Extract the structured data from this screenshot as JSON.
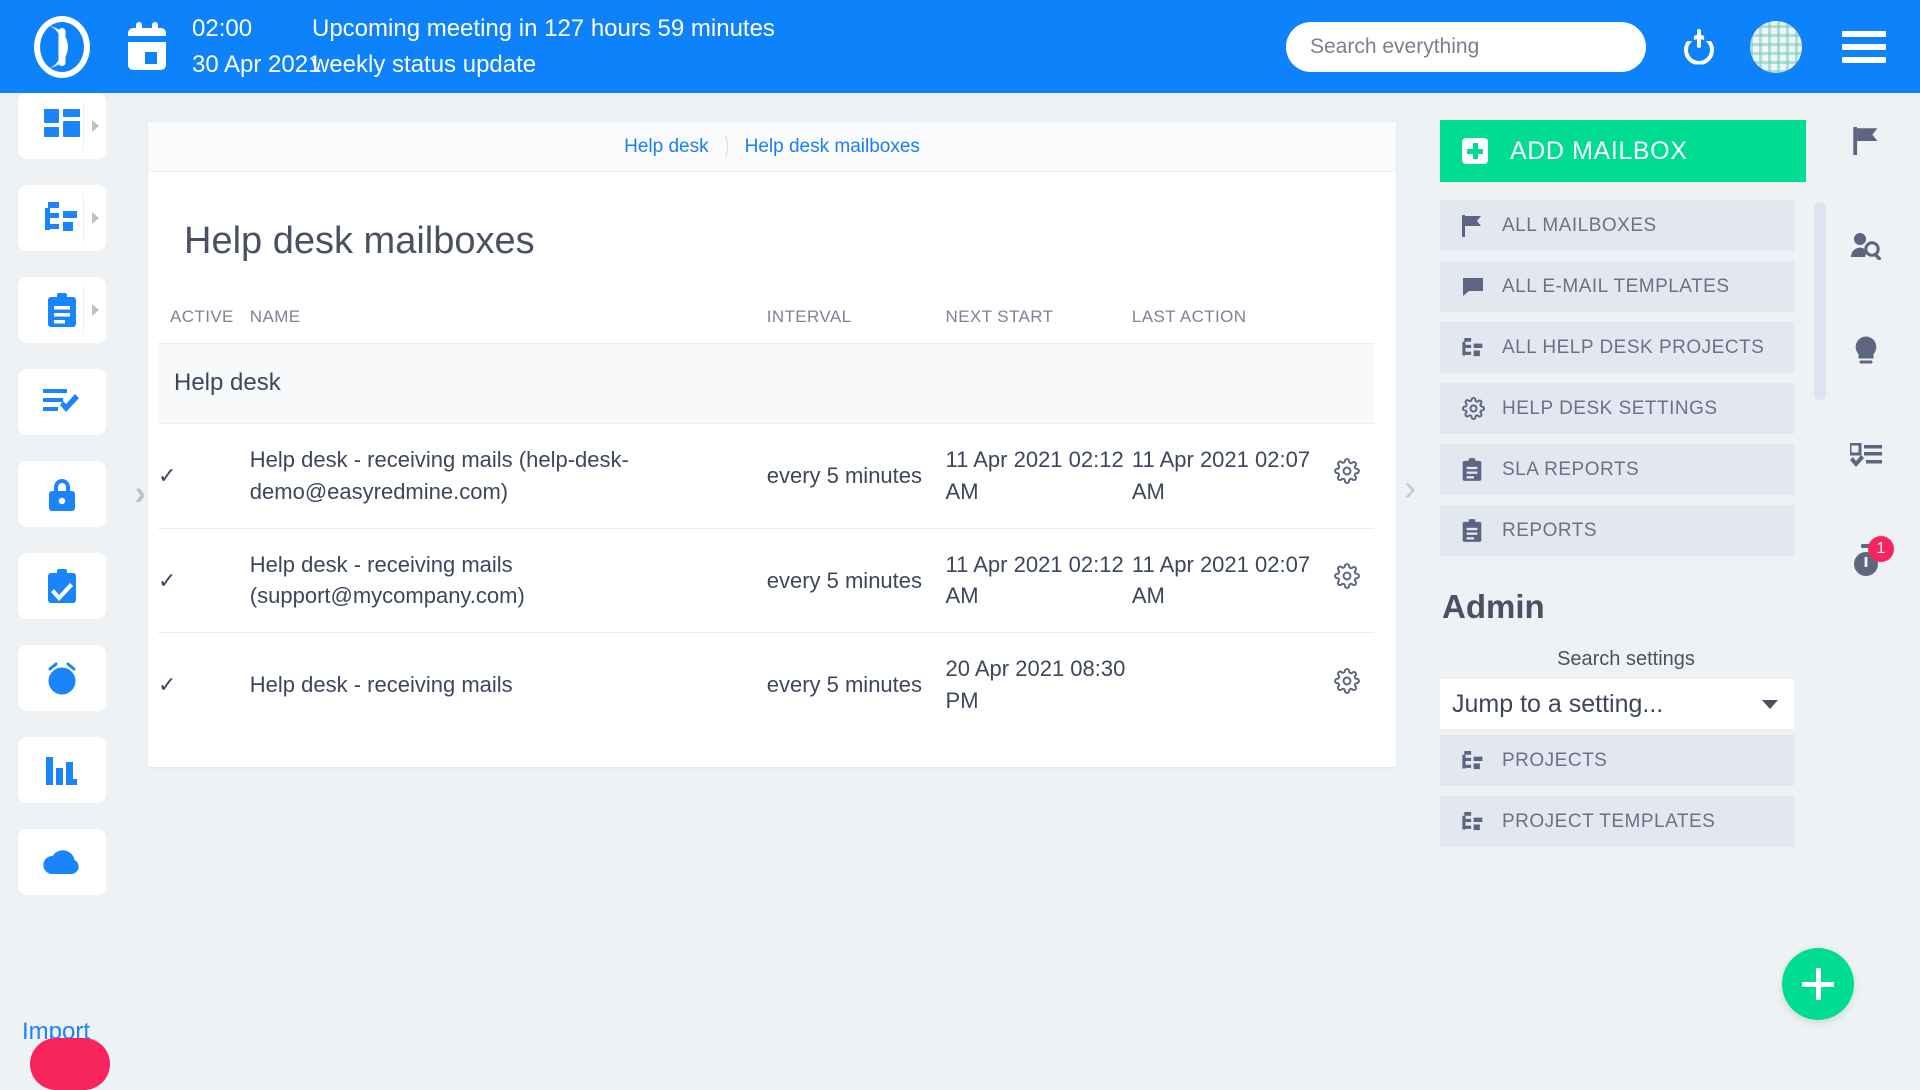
{
  "topbar": {
    "logo_name": "easy-redmine-logo",
    "calendar_icon": "calendar-icon",
    "meeting_time": "02:00",
    "meeting_date": "30 Apr 2021",
    "meeting_headline": "Upcoming meeting in 127 hours 59 minutes",
    "meeting_subject": "weekly status update",
    "search_placeholder": "Search everything",
    "search_value": "",
    "power_icon": "power-icon",
    "avatar": "user-avatar",
    "menu_icon": "hamburger-menu-icon",
    "bg_color": "#0e82fb"
  },
  "left_rail": {
    "expand_arrow": "›",
    "import_label": "Import",
    "items": [
      {
        "name": "dashboard",
        "icon": "dashboard-grid-icon",
        "has_caret": true
      },
      {
        "name": "projects",
        "icon": "project-tree-icon",
        "has_caret": true
      },
      {
        "name": "tasks",
        "icon": "clipboard-lines-icon",
        "has_caret": true
      },
      {
        "name": "task-list-check",
        "icon": "list-check-icon",
        "has_caret": false
      },
      {
        "name": "security",
        "icon": "lock-icon",
        "has_caret": false
      },
      {
        "name": "approvals",
        "icon": "clipboard-check-icon",
        "has_caret": false
      },
      {
        "name": "time-tracking",
        "icon": "alarm-plus-icon",
        "has_caret": false
      },
      {
        "name": "reports",
        "icon": "bar-chart-icon",
        "has_caret": false
      },
      {
        "name": "import",
        "icon": "cloud-icon",
        "has_caret": false
      }
    ]
  },
  "main": {
    "breadcrumb": [
      {
        "label": "Help desk"
      },
      {
        "label": "Help desk mailboxes"
      }
    ],
    "page_title": "Help desk mailboxes",
    "table": {
      "columns": [
        "ACTIVE",
        "NAME",
        "INTERVAL",
        "NEXT START",
        "LAST ACTION"
      ],
      "group_label": "Help desk",
      "check_glyph": "✓",
      "gear_icon": "gear-icon",
      "rows": [
        {
          "active": "✓",
          "name": "Help desk - receiving mails (help-desk-demo@easyredmine.com)",
          "interval": "every 5 minutes",
          "next_start": "11 Apr 2021 02:12 AM",
          "last_action": "11 Apr 2021 02:07 AM"
        },
        {
          "active": "✓",
          "name": "Help desk - receiving mails (support@mycompany.com)",
          "interval": "every 5 minutes",
          "next_start": "11 Apr 2021 02:12 AM",
          "last_action": "11 Apr 2021 02:07 AM"
        },
        {
          "active": "✓",
          "name": "Help desk - receiving mails",
          "interval": "every 5 minutes",
          "next_start": "20 Apr 2021 08:30 PM",
          "last_action": ""
        }
      ]
    },
    "collapse_arrow": "›"
  },
  "right_panel": {
    "add_button": {
      "label": "ADD MAILBOX",
      "icon": "plus-square-icon",
      "color": "#00dd92"
    },
    "menu": [
      {
        "label": "ALL MAILBOXES",
        "icon": "flag-icon"
      },
      {
        "label": "ALL E-MAIL TEMPLATES",
        "icon": "chat-bubble-icon"
      },
      {
        "label": "ALL HELP DESK PROJECTS",
        "icon": "project-tree-icon"
      },
      {
        "label": "HELP DESK SETTINGS",
        "icon": "gear-icon"
      },
      {
        "label": "SLA REPORTS",
        "icon": "clipboard-lines-icon"
      },
      {
        "label": "REPORTS",
        "icon": "clipboard-lines-icon"
      }
    ],
    "admin": {
      "title": "Admin",
      "search_label": "Search settings",
      "select_value": "Jump to a setting...",
      "items": [
        {
          "label": "PROJECTS",
          "icon": "project-tree-icon"
        },
        {
          "label": "PROJECT TEMPLATES",
          "icon": "project-tree-icon"
        }
      ]
    }
  },
  "far_rail": {
    "items": [
      {
        "name": "flag",
        "icon": "flag-icon",
        "badge": ""
      },
      {
        "name": "user-search",
        "icon": "user-search-icon",
        "badge": ""
      },
      {
        "name": "ideas",
        "icon": "lightbulb-icon",
        "badge": ""
      },
      {
        "name": "checklist",
        "icon": "checklist-icon",
        "badge": ""
      },
      {
        "name": "timer",
        "icon": "stopwatch-icon",
        "badge": "1"
      }
    ]
  },
  "fab": {
    "name": "add-new-fab",
    "icon": "plus-icon",
    "color": "#00dd92"
  }
}
